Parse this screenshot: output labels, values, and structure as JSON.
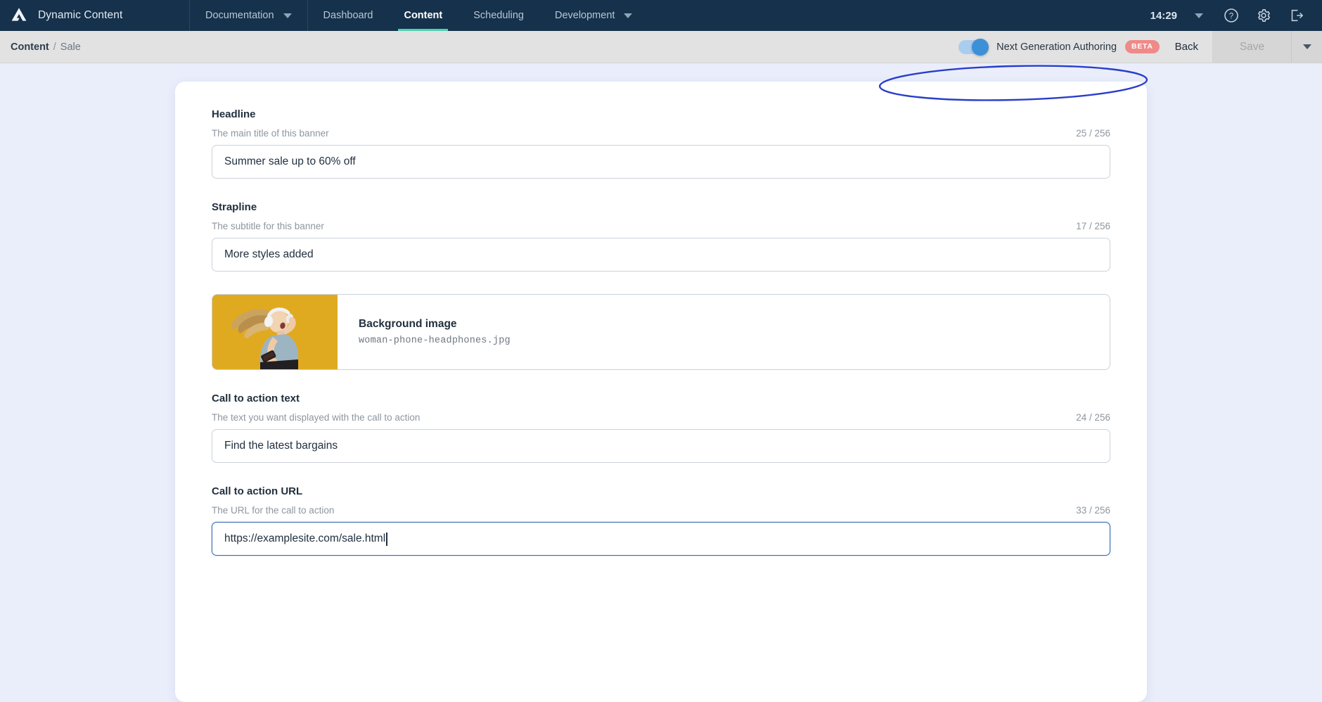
{
  "topnav": {
    "logo_icon": "amplience-logo-icon",
    "brand": "Dynamic Content",
    "items": [
      {
        "label": "Documentation",
        "icon": "chevron-down-icon",
        "active": false
      },
      {
        "label": "Dashboard",
        "active": false
      },
      {
        "label": "Content",
        "active": true
      },
      {
        "label": "Scheduling",
        "active": false
      },
      {
        "label": "Development",
        "icon": "chevron-down-icon",
        "active": false
      }
    ],
    "clock": "14:29",
    "user_caret_icon": "chevron-down-icon",
    "help_icon": "help-circle-icon",
    "settings_icon": "gear-icon",
    "logout_icon": "logout-icon",
    "accent_active": "#4fd1b0",
    "bar_color": "#15314b"
  },
  "toolbar": {
    "breadcrumb_root": "Content",
    "breadcrumb_sep": "/",
    "breadcrumb_leaf": "Sale",
    "next_gen_label": "Next Generation Authoring",
    "beta_badge": "BETA",
    "toggle_state": "on",
    "toggle_color": "#3c90d8",
    "beta_color": "#ef8a88",
    "back_label": "Back",
    "save_label": "Save",
    "save_enabled": false,
    "save_caret_icon": "chevron-down-icon",
    "annotation": "blue-ellipse-highlight"
  },
  "form": {
    "fields": [
      {
        "label": "Headline",
        "help": "The main title of this banner",
        "count": "25 / 256",
        "value": "Summer sale up to 60% off",
        "focused": false
      },
      {
        "label": "Strapline",
        "help": "The subtitle for this banner",
        "count": "17 / 256",
        "value": "More styles added",
        "focused": false
      },
      {
        "label": "Call to action text",
        "help": "The text you want displayed with the call to action",
        "count": "24 / 256",
        "value": "Find the latest bargains",
        "focused": false
      },
      {
        "label": "Call to action URL",
        "help": "The URL for the call to action",
        "count": "33 / 256",
        "value": "https://examplesite.com/sale.html",
        "focused": true
      }
    ],
    "image_card": {
      "title": "Background image",
      "filename": "woman-phone-headphones.jpg",
      "thumb_bg": "#e0aa20",
      "thumb_alt": "woman-with-headphones-thumbnail"
    }
  }
}
